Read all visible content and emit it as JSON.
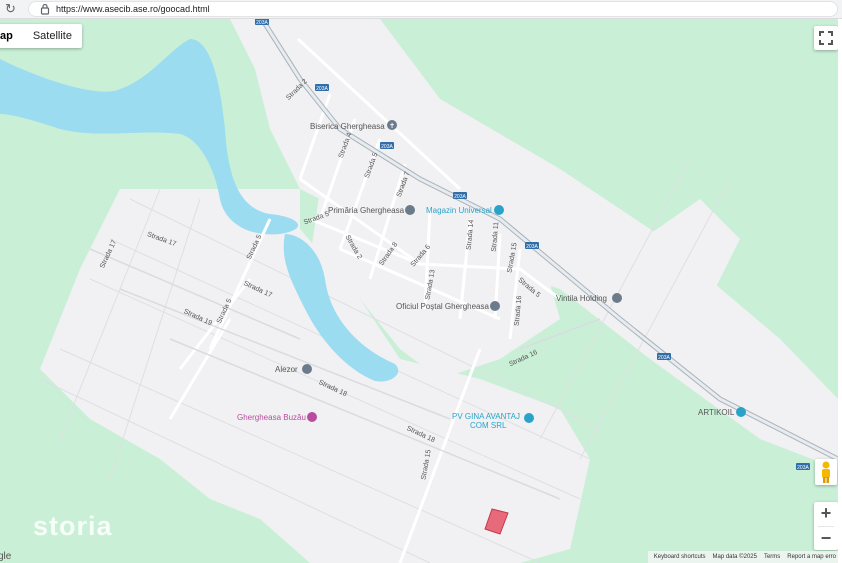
{
  "browser": {
    "url": "https://www.asecib.ase.ro/goocad.html"
  },
  "map_type": {
    "map_label": "ap",
    "satellite_label": "Satellite",
    "active": "Map"
  },
  "zoom": {
    "in": "+",
    "out": "−"
  },
  "colors": {
    "land": "#c9f0d6",
    "settlement": "#f1f1f3",
    "water": "#9bdcf1",
    "road": "#d3d6db",
    "highway": "#b8c2cc",
    "poi": "#6b7b8c",
    "blue_poi": "#2aa3c8",
    "pink_poi": "#b84d9f",
    "parcel": "#e86a7a"
  },
  "pois": [
    {
      "name": "Biserica Ghergheasa",
      "icon": "church-icon",
      "category": "gray"
    },
    {
      "name": "Primăria Ghergheasa",
      "icon": "townhall-icon",
      "category": "gray"
    },
    {
      "name": "Magazin Universal",
      "icon": "shop-icon",
      "category": "blue"
    },
    {
      "name": "Oficiul Poștal Ghergheasa",
      "icon": "post-icon",
      "category": "gray"
    },
    {
      "name": "Vintila Holding",
      "icon": "place-icon",
      "category": "gray"
    },
    {
      "name": "Alezor",
      "icon": "place-icon",
      "category": "gray"
    },
    {
      "name": "Ghergheasa Buzău",
      "icon": "pin-icon",
      "category": "pink"
    },
    {
      "name": "PV GINA AVANTAJ COM SRL",
      "icon": "shop-icon",
      "category": "blue"
    },
    {
      "name": "ARTIKOIL",
      "icon": "fuel-icon",
      "category": "blue"
    }
  ],
  "streets": [
    "Strada 2",
    "Strada 4",
    "Strada 5",
    "Strada 7",
    "Strada 5",
    "Strada 2",
    "Strada 8",
    "Strada 6",
    "Strada 13",
    "Strada 14",
    "Strada 11",
    "Strada 15",
    "Strada 5",
    "Strada 16",
    "Strada 16",
    "Strada 17",
    "Strada 17",
    "Strada 5",
    "Strada 19",
    "Strada 18",
    "Strada 18",
    "Strada 15"
  ],
  "route_shields": [
    "203A",
    "203A",
    "203A",
    "203A",
    "203A",
    "203A",
    "203A"
  ],
  "attribution": {
    "keyboard": "Keyboard shortcuts",
    "map_data": "Map data ©2025",
    "terms": "Terms",
    "report": "Report a map erro"
  },
  "google_logo": "gle",
  "watermark": "storia"
}
